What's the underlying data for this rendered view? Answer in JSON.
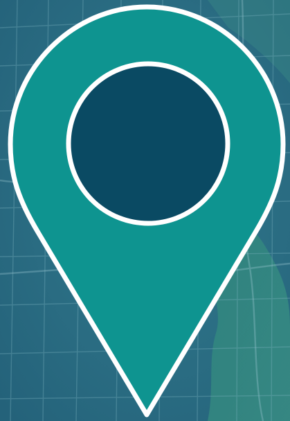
{
  "scene": {
    "background_color": "#2b6c80",
    "map_line_color": "#6fa9b6",
    "water_color": "#3d8f7f"
  },
  "pin": {
    "icon": "map-pin-icon",
    "fill_color": "#0e9490",
    "outline_color": "#ffffff",
    "dot_color": "#0a4a63"
  }
}
